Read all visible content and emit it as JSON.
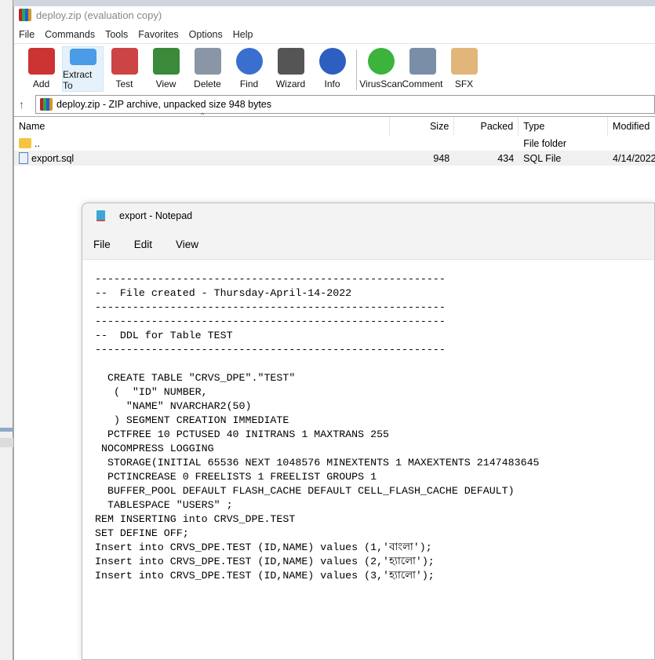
{
  "winrar": {
    "title": "deploy.zip (evaluation copy)",
    "menu": [
      "File",
      "Commands",
      "Tools",
      "Favorites",
      "Options",
      "Help"
    ],
    "toolbar": [
      {
        "label": "Add",
        "icon": "add-icon",
        "color": "#c33"
      },
      {
        "label": "Extract To",
        "icon": "extract-folder-icon",
        "color": "#4a9be8"
      },
      {
        "label": "Test",
        "icon": "test-clipboard-icon",
        "color": "#c44"
      },
      {
        "label": "View",
        "icon": "view-book-icon",
        "color": "#3a8a3a"
      },
      {
        "label": "Delete",
        "icon": "delete-trash-icon",
        "color": "#8a96a6"
      },
      {
        "label": "Find",
        "icon": "find-magnifier-icon",
        "color": "#3a6fd0"
      },
      {
        "label": "Wizard",
        "icon": "wizard-wand-icon",
        "color": "#555"
      },
      {
        "label": "Info",
        "icon": "info-icon",
        "color": "#2c5fc0"
      },
      {
        "label": "VirusScan",
        "icon": "virusscan-icon",
        "color": "#3cb33c"
      },
      {
        "label": "Comment",
        "icon": "comment-icon",
        "color": "#7a8ea8"
      },
      {
        "label": "SFX",
        "icon": "sfx-box-icon",
        "color": "#e2b57a"
      }
    ],
    "address": "deploy.zip - ZIP archive, unpacked size 948 bytes",
    "columns": [
      "Name",
      "Size",
      "Packed",
      "Type",
      "Modified"
    ],
    "rows": [
      {
        "name": "..",
        "size": "",
        "packed": "",
        "type": "File folder",
        "modified": ""
      },
      {
        "name": "export.sql",
        "size": "948",
        "packed": "434",
        "type": "SQL File",
        "modified": "4/14/2022"
      }
    ]
  },
  "notepad": {
    "title": "export - Notepad",
    "menu": [
      "File",
      "Edit",
      "View"
    ],
    "content": "--------------------------------------------------------\n--  File created - Thursday-April-14-2022\n--------------------------------------------------------\n--------------------------------------------------------\n--  DDL for Table TEST\n--------------------------------------------------------\n\n  CREATE TABLE \"CRVS_DPE\".\"TEST\"\n   (  \"ID\" NUMBER,\n     \"NAME\" NVARCHAR2(50)\n   ) SEGMENT CREATION IMMEDIATE\n  PCTFREE 10 PCTUSED 40 INITRANS 1 MAXTRANS 255\n NOCOMPRESS LOGGING\n  STORAGE(INITIAL 65536 NEXT 1048576 MINEXTENTS 1 MAXEXTENTS 2147483645\n  PCTINCREASE 0 FREELISTS 1 FREELIST GROUPS 1\n  BUFFER_POOL DEFAULT FLASH_CACHE DEFAULT CELL_FLASH_CACHE DEFAULT)\n  TABLESPACE \"USERS\" ;\nREM INSERTING into CRVS_DPE.TEST\nSET DEFINE OFF;\nInsert into CRVS_DPE.TEST (ID,NAME) values (1,'বাংলা');\nInsert into CRVS_DPE.TEST (ID,NAME) values (2,'হ্যালো');\nInsert into CRVS_DPE.TEST (ID,NAME) values (3,'হ্যালো');"
  }
}
